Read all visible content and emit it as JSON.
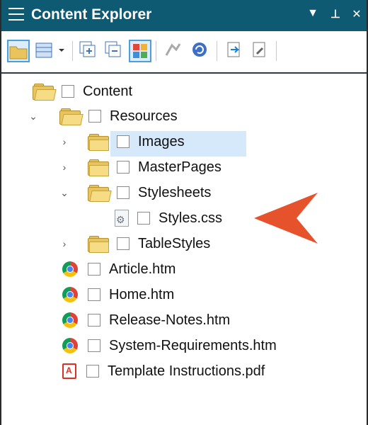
{
  "panel": {
    "title": "Content Explorer",
    "dropdown_glyph": "▼",
    "pin_glyph": "⊥",
    "close_glyph": "✕"
  },
  "toolbar": {
    "items": [
      {
        "icon": "folder-icon",
        "selected": true
      },
      {
        "icon": "view-layout-icon",
        "selected": false
      },
      {
        "icon": "expand-all-icon",
        "selected": false
      },
      {
        "icon": "collapse-all-icon",
        "selected": false
      },
      {
        "icon": "show-colors-icon",
        "selected": true
      },
      {
        "icon": "bind-icon",
        "selected": false
      },
      {
        "icon": "refresh-icon",
        "selected": false
      },
      {
        "icon": "open-icon",
        "selected": false
      },
      {
        "icon": "properties-icon",
        "selected": false
      }
    ]
  },
  "tree": {
    "items": [
      {
        "label": "Content",
        "icon": "open-folder-icon",
        "expanded": true
      },
      {
        "label": "Resources",
        "icon": "open-folder-icon",
        "expanded": true
      },
      {
        "label": "Images",
        "icon": "folder-icon",
        "expanded": false
      },
      {
        "label": "MasterPages",
        "icon": "folder-icon",
        "expanded": false
      },
      {
        "label": "Stylesheets",
        "icon": "open-folder-icon",
        "expanded": true
      },
      {
        "label": "Styles.css",
        "icon": "stylesheet-file-icon",
        "selected": true
      },
      {
        "label": "TableStyles",
        "icon": "folder-icon",
        "expanded": false
      },
      {
        "label": "Article.htm",
        "icon": "chrome-icon"
      },
      {
        "label": "Home.htm",
        "icon": "chrome-icon"
      },
      {
        "label": "Release-Notes.htm",
        "icon": "chrome-icon"
      },
      {
        "label": "System-Requirements.htm",
        "icon": "chrome-icon"
      },
      {
        "label": "Template Instructions.pdf",
        "icon": "pdf-icon"
      }
    ]
  },
  "colors": {
    "titlebar": "#0f5a73",
    "selection": "#d6e9fb",
    "callout_arrow": "#e5522b"
  }
}
